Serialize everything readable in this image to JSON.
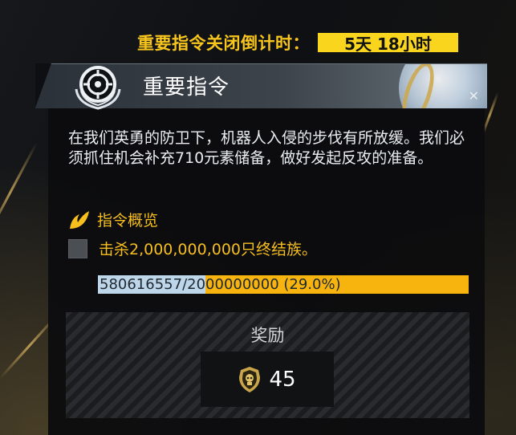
{
  "countdown": {
    "label": "重要指令关闭倒计时：",
    "value": "5天 18小时"
  },
  "order": {
    "title": "重要指令",
    "description": "在我们英勇的防卫下，机器人入侵的步伐有所放缓。我们必须抓住机会补充710元素储备，做好发起反攻的准备。",
    "section_label": "指令概览",
    "task_label": "击杀2,000,000,000只终结族。",
    "progress": {
      "text": "580616557/2000000000 (29.0%)",
      "current": 580616557,
      "goal": 2000000000,
      "fraction": 0.29
    },
    "reward": {
      "label": "奖励",
      "amount": "45",
      "icon": "medal-icon"
    }
  },
  "colors": {
    "accent": "#f6bf1e",
    "countdown_bg": "#f9d51d",
    "progress_fill": "#bed6ea",
    "progress_bg": "#f8b40e",
    "panel_bg": "#0c0d0f"
  }
}
